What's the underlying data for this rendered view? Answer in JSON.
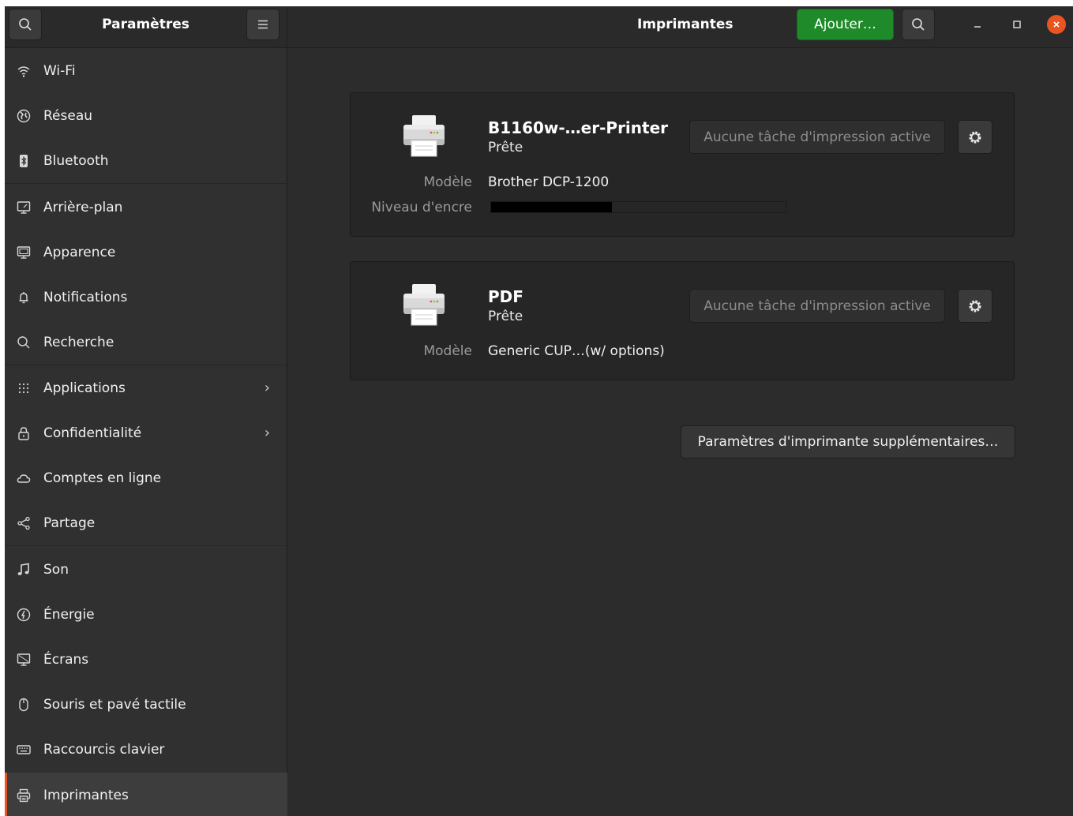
{
  "sidebar": {
    "title": "Paramètres",
    "items": [
      {
        "label": "Wi-Fi",
        "icon": "wifi-icon",
        "name": "wifi"
      },
      {
        "label": "Réseau",
        "icon": "network-icon",
        "name": "reseau"
      },
      {
        "label": "Bluetooth",
        "icon": "bluetooth-icon",
        "name": "bluetooth"
      },
      {
        "label": "Arrière-plan",
        "icon": "background-icon",
        "name": "arriere-plan"
      },
      {
        "label": "Apparence",
        "icon": "appearance-icon",
        "name": "apparence"
      },
      {
        "label": "Notifications",
        "icon": "bell-icon",
        "name": "notifications"
      },
      {
        "label": "Recherche",
        "icon": "search-icon",
        "name": "recherche"
      },
      {
        "label": "Applications",
        "icon": "apps-grid-icon",
        "name": "applications",
        "chevron": "›"
      },
      {
        "label": "Confidentialité",
        "icon": "lock-icon",
        "name": "confidentialite",
        "chevron": "›"
      },
      {
        "label": "Comptes en ligne",
        "icon": "cloud-icon",
        "name": "comptes-en-ligne"
      },
      {
        "label": "Partage",
        "icon": "share-icon",
        "name": "partage"
      },
      {
        "label": "Son",
        "icon": "music-note-icon",
        "name": "son"
      },
      {
        "label": "Énergie",
        "icon": "power-icon",
        "name": "energie"
      },
      {
        "label": "Écrans",
        "icon": "display-icon",
        "name": "ecrans"
      },
      {
        "label": "Souris et pavé tactile",
        "icon": "mouse-icon",
        "name": "souris"
      },
      {
        "label": "Raccourcis clavier",
        "icon": "keyboard-icon",
        "name": "raccourcis"
      },
      {
        "label": "Imprimantes",
        "icon": "printer-icon",
        "name": "imprimantes",
        "active": true
      }
    ]
  },
  "header": {
    "title": "Imprimantes",
    "add_label": "Ajouter…"
  },
  "printers": [
    {
      "name": "B1160w-…er-Printer",
      "status": "Prête",
      "jobs_label": "Aucune tâche d'impression active",
      "model_label": "Modèle",
      "model": "Brother DCP-1200",
      "ink_label": "Niveau d'encre",
      "ink_level": 0.41
    },
    {
      "name": "PDF",
      "status": "Prête",
      "jobs_label": "Aucune tâche d'impression active",
      "model_label": "Modèle",
      "model": "Generic CUP…(w/ options)"
    }
  ],
  "more_settings_label": "Paramètres d'imprimante supplémentaires…",
  "colors": {
    "accent": "#e95420",
    "add_button": "#1f8a2a"
  }
}
